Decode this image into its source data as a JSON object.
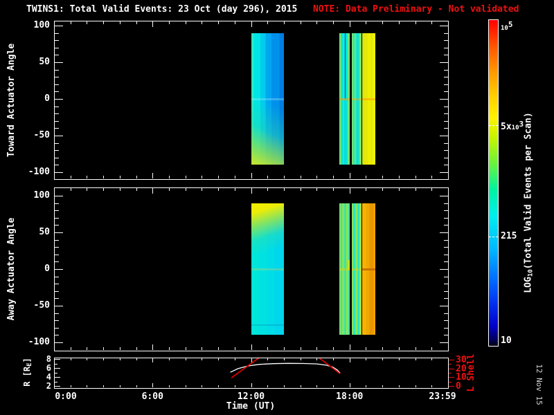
{
  "title": "TWINS1: Total Valid Events: 23 Oct (day 296), 2015",
  "note": "NOTE: Data Preliminary - Not validated",
  "date_stamp": "12 Nov 15",
  "colors": {
    "background": "#000000",
    "axis": "#ffffff",
    "note_red": "#f01010",
    "lshell_red": "#f01010",
    "r_curve": "#ffffff",
    "date_gray": "#d4d4d4"
  },
  "axes": {
    "x_label": "Time (UT)",
    "x_tick_labels": [
      {
        "h": 0,
        "label": "0:00"
      },
      {
        "h": 6,
        "label": "6:00"
      },
      {
        "h": 12,
        "label": "12:00"
      },
      {
        "h": 18,
        "label": "18:00"
      },
      {
        "h": 23.9833,
        "label": "23:59"
      }
    ],
    "panel1_ylabel": "Toward Actuator Angle",
    "panel2_ylabel": "Away Actuator Angle",
    "angle_ticks": [
      100,
      50,
      0,
      -50,
      -100
    ],
    "angle_minor_step": 10,
    "hour_minor_step": 1,
    "r_label": {
      "pre": "R [R",
      "sub": "E",
      "post": "]"
    },
    "r_ticks": [
      8,
      6,
      4,
      2
    ],
    "r_minor_ticks": [
      7,
      5,
      3
    ],
    "l_label": "L Shell",
    "l_ticks": [
      30,
      20,
      10,
      0
    ],
    "l_minor_ticks": [
      25,
      15,
      5
    ]
  },
  "colorbar": {
    "label": {
      "pre": "LOG",
      "sub": "10",
      "post": "(Total Valid Events per Scan)"
    },
    "scale": "log10",
    "range": [
      10,
      100000
    ],
    "ticks": [
      {
        "pre": "",
        "base": "10",
        "sup": "5",
        "frac": 0.0,
        "dash": false
      },
      {
        "pre": "5x",
        "base": "10",
        "sup": "3",
        "frac": 0.325,
        "dash": true
      },
      {
        "pre": "215",
        "base": "",
        "sup": "",
        "frac": 0.667,
        "dash": true
      },
      {
        "pre": "10",
        "base": "",
        "sup": "",
        "frac": 1.0,
        "dash": false
      }
    ],
    "stops": [
      [
        "#ff0000",
        0
      ],
      [
        "#ff5500",
        8
      ],
      [
        "#ff9900",
        16
      ],
      [
        "#ffcc00",
        23
      ],
      [
        "#fff200",
        30
      ],
      [
        "#c8f400",
        36
      ],
      [
        "#6cf23c",
        44
      ],
      [
        "#00f2a0",
        52
      ],
      [
        "#00eeee",
        60
      ],
      [
        "#00baff",
        70
      ],
      [
        "#0072ff",
        79
      ],
      [
        "#0030f0",
        87
      ],
      [
        "#0000c8",
        94
      ],
      [
        "#000060",
        98
      ],
      [
        "#000010",
        100
      ]
    ]
  },
  "chart_data": [
    {
      "type": "heatmap",
      "panel": "toward",
      "ylabel": "Toward Actuator Angle",
      "xlim_hours": [
        0,
        24
      ],
      "ylim_deg": [
        -107,
        107
      ],
      "bands": [
        {
          "t0": 12.0,
          "t1": 14.0,
          "deg_top": 90,
          "deg_bottom": -90,
          "stripes": [
            [
              "#2ce8c4",
              0,
              0.07
            ],
            [
              "#00e6e6",
              0.07,
              0.28
            ],
            [
              "#00ccee",
              0.28,
              0.44
            ],
            [
              "#00a6f0",
              0.44,
              0.62
            ],
            [
              "#0092ea",
              0.62,
              0.86
            ],
            [
              "#007ee2",
              0.86,
              1
            ]
          ],
          "overlay": "linear-gradient(25deg, #cbe52a 0%, rgba(140,222,80,0.8) 13%, rgba(40,214,170,0.45) 28%, rgba(0,224,224,0) 48%)",
          "zero_line": "rgba(190,240,255,0.3)"
        },
        {
          "t0": 17.38,
          "t1": 18.01,
          "deg_top": 90,
          "deg_bottom": -90,
          "stripes": [
            [
              "#b4dc1e",
              0,
              0.09
            ],
            [
              "#46e6a0",
              0.09,
              0.17
            ],
            [
              "#00e4e0",
              0.17,
              0.34
            ],
            [
              "#3ee4b4",
              0.34,
              0.43
            ],
            [
              "#00e0e4",
              0.43,
              0.6
            ],
            [
              "#00e2dc",
              0.6,
              0.75
            ],
            [
              "#3ce4ae",
              0.75,
              0.87
            ],
            [
              "#8ce05a",
              0.87,
              1
            ]
          ],
          "zero_line": "rgba(250,160,10,0.55)",
          "vlines": [
            {
              "f0": 0.55,
              "f1": 0.62,
              "deg0": 90,
              "deg1": 0,
              "color": "#0052c8"
            }
          ]
        },
        {
          "t0": 18.14,
          "t1": 18.73,
          "deg_top": 90,
          "deg_bottom": -90,
          "stripes": [
            [
              "#7ce462",
              0,
              0.12
            ],
            [
              "#28e6c2",
              0.12,
              0.3
            ],
            [
              "#66e67e",
              0.3,
              0.46
            ],
            [
              "#00e2e2",
              0.46,
              0.72
            ],
            [
              "#52e496",
              0.72,
              0.86
            ],
            [
              "#8ae05c",
              0.86,
              1
            ]
          ],
          "zero_line": "rgba(250,170,10,0.45)"
        },
        {
          "t0": 18.77,
          "t1": 19.57,
          "deg_top": 90,
          "deg_bottom": -90,
          "stripes": [
            [
              "#b0e22c",
              0,
              0.09
            ],
            [
              "#e6e60a",
              0.09,
              0.42
            ],
            [
              "#f0ee00",
              0.42,
              0.66
            ],
            [
              "#dcea14",
              0.66,
              0.8
            ],
            [
              "#f2f000",
              0.8,
              1
            ]
          ],
          "zero_line": "rgba(255,150,0,0.5)"
        }
      ]
    },
    {
      "type": "heatmap",
      "panel": "away",
      "ylabel": "Away Actuator Angle",
      "xlim_hours": [
        0,
        24
      ],
      "ylim_deg": [
        -107,
        107
      ],
      "bands": [
        {
          "t0": 12.0,
          "t1": 14.0,
          "deg_top": 90,
          "deg_bottom": -90,
          "stripes": [
            [
              "#00e6da",
              0,
              0.22
            ],
            [
              "#00e2e2",
              0.22,
              0.48
            ],
            [
              "#00dce8",
              0.48,
              0.72
            ],
            [
              "#00d6ec",
              0.72,
              1
            ]
          ],
          "overlay": "linear-gradient(162deg, #f0ee00 0%, #eeec06 7%, rgba(170,228,60,0.75) 17%, rgba(60,220,160,0.4) 27%, rgba(0,224,224,0) 38%)",
          "zero_line": "rgba(230,210,80,0.3)",
          "extra_lines": [
            {
              "deg": -75,
              "color": "rgba(0,150,190,0.4)"
            }
          ]
        },
        {
          "t0": 17.38,
          "t1": 18.01,
          "deg_top": 90,
          "deg_bottom": -90,
          "stripes": [
            [
              "#8ae052",
              0,
              0.12
            ],
            [
              "#30e6b8",
              0.12,
              0.26
            ],
            [
              "#84e45c",
              0.26,
              0.5
            ],
            [
              "#16e6d0",
              0.5,
              0.64
            ],
            [
              "#90e452",
              0.64,
              0.84
            ],
            [
              "#48e6a4",
              0.84,
              1
            ]
          ],
          "zero_line": "rgba(240,210,0,0.45)",
          "vlines": [
            {
              "f0": 0.87,
              "f1": 0.97,
              "deg0": 12,
              "deg1": -2,
              "color": "#e8e400"
            }
          ]
        },
        {
          "t0": 18.14,
          "t1": 18.73,
          "deg_top": 90,
          "deg_bottom": -90,
          "stripes": [
            [
              "#7ee45e",
              0,
              0.14
            ],
            [
              "#2ae6c0",
              0.14,
              0.34
            ],
            [
              "#8ce454",
              0.34,
              0.62
            ],
            [
              "#24e6c6",
              0.62,
              0.78
            ],
            [
              "#9ae24a",
              0.78,
              1
            ]
          ],
          "zero_line": "rgba(240,200,0,0.4)"
        },
        {
          "t0": 18.77,
          "t1": 19.57,
          "deg_top": 90,
          "deg_bottom": -90,
          "stripes": [
            [
              "#f4b400",
              0,
              0.28
            ],
            [
              "#f0a800",
              0.28,
              0.55
            ],
            [
              "#ea9600",
              0.55,
              0.88
            ],
            [
              "#f2a400",
              0.88,
              1
            ]
          ],
          "zero_line": "rgba(190,100,0,0.8)"
        }
      ]
    },
    {
      "type": "line",
      "panel": "ephemeris",
      "r_axis": {
        "ticks": [
          2,
          4,
          6,
          8
        ],
        "range_at_edges": [
          1.5,
          8.3
        ]
      },
      "l_axis": {
        "ticks": [
          0,
          10,
          20,
          30
        ],
        "range_at_edges": [
          0,
          32
        ]
      },
      "series": [
        {
          "name": "R [RE]",
          "axis": "R",
          "color": "#ffffff",
          "points": [
            [
              10.74,
              5.05
            ],
            [
              11.2,
              5.85
            ],
            [
              11.8,
              6.45
            ],
            [
              12.5,
              6.8
            ],
            [
              13.4,
              6.97
            ],
            [
              14.3,
              7.03
            ],
            [
              15.2,
              7.0
            ],
            [
              16.0,
              6.9
            ],
            [
              16.6,
              6.62
            ],
            [
              17.0,
              6.15
            ],
            [
              17.25,
              5.55
            ],
            [
              17.43,
              4.85
            ]
          ]
        },
        {
          "name": "L Shell",
          "axis": "L",
          "color": "#e80000",
          "points": [
            [
              10.8,
              9.2
            ],
            [
              12.55,
              33
            ]
          ]
        },
        {
          "name": "L Shell",
          "axis": "L",
          "color": "#e80000",
          "points": [
            [
              16.15,
              32
            ],
            [
              17.43,
              14
            ]
          ]
        }
      ]
    }
  ]
}
